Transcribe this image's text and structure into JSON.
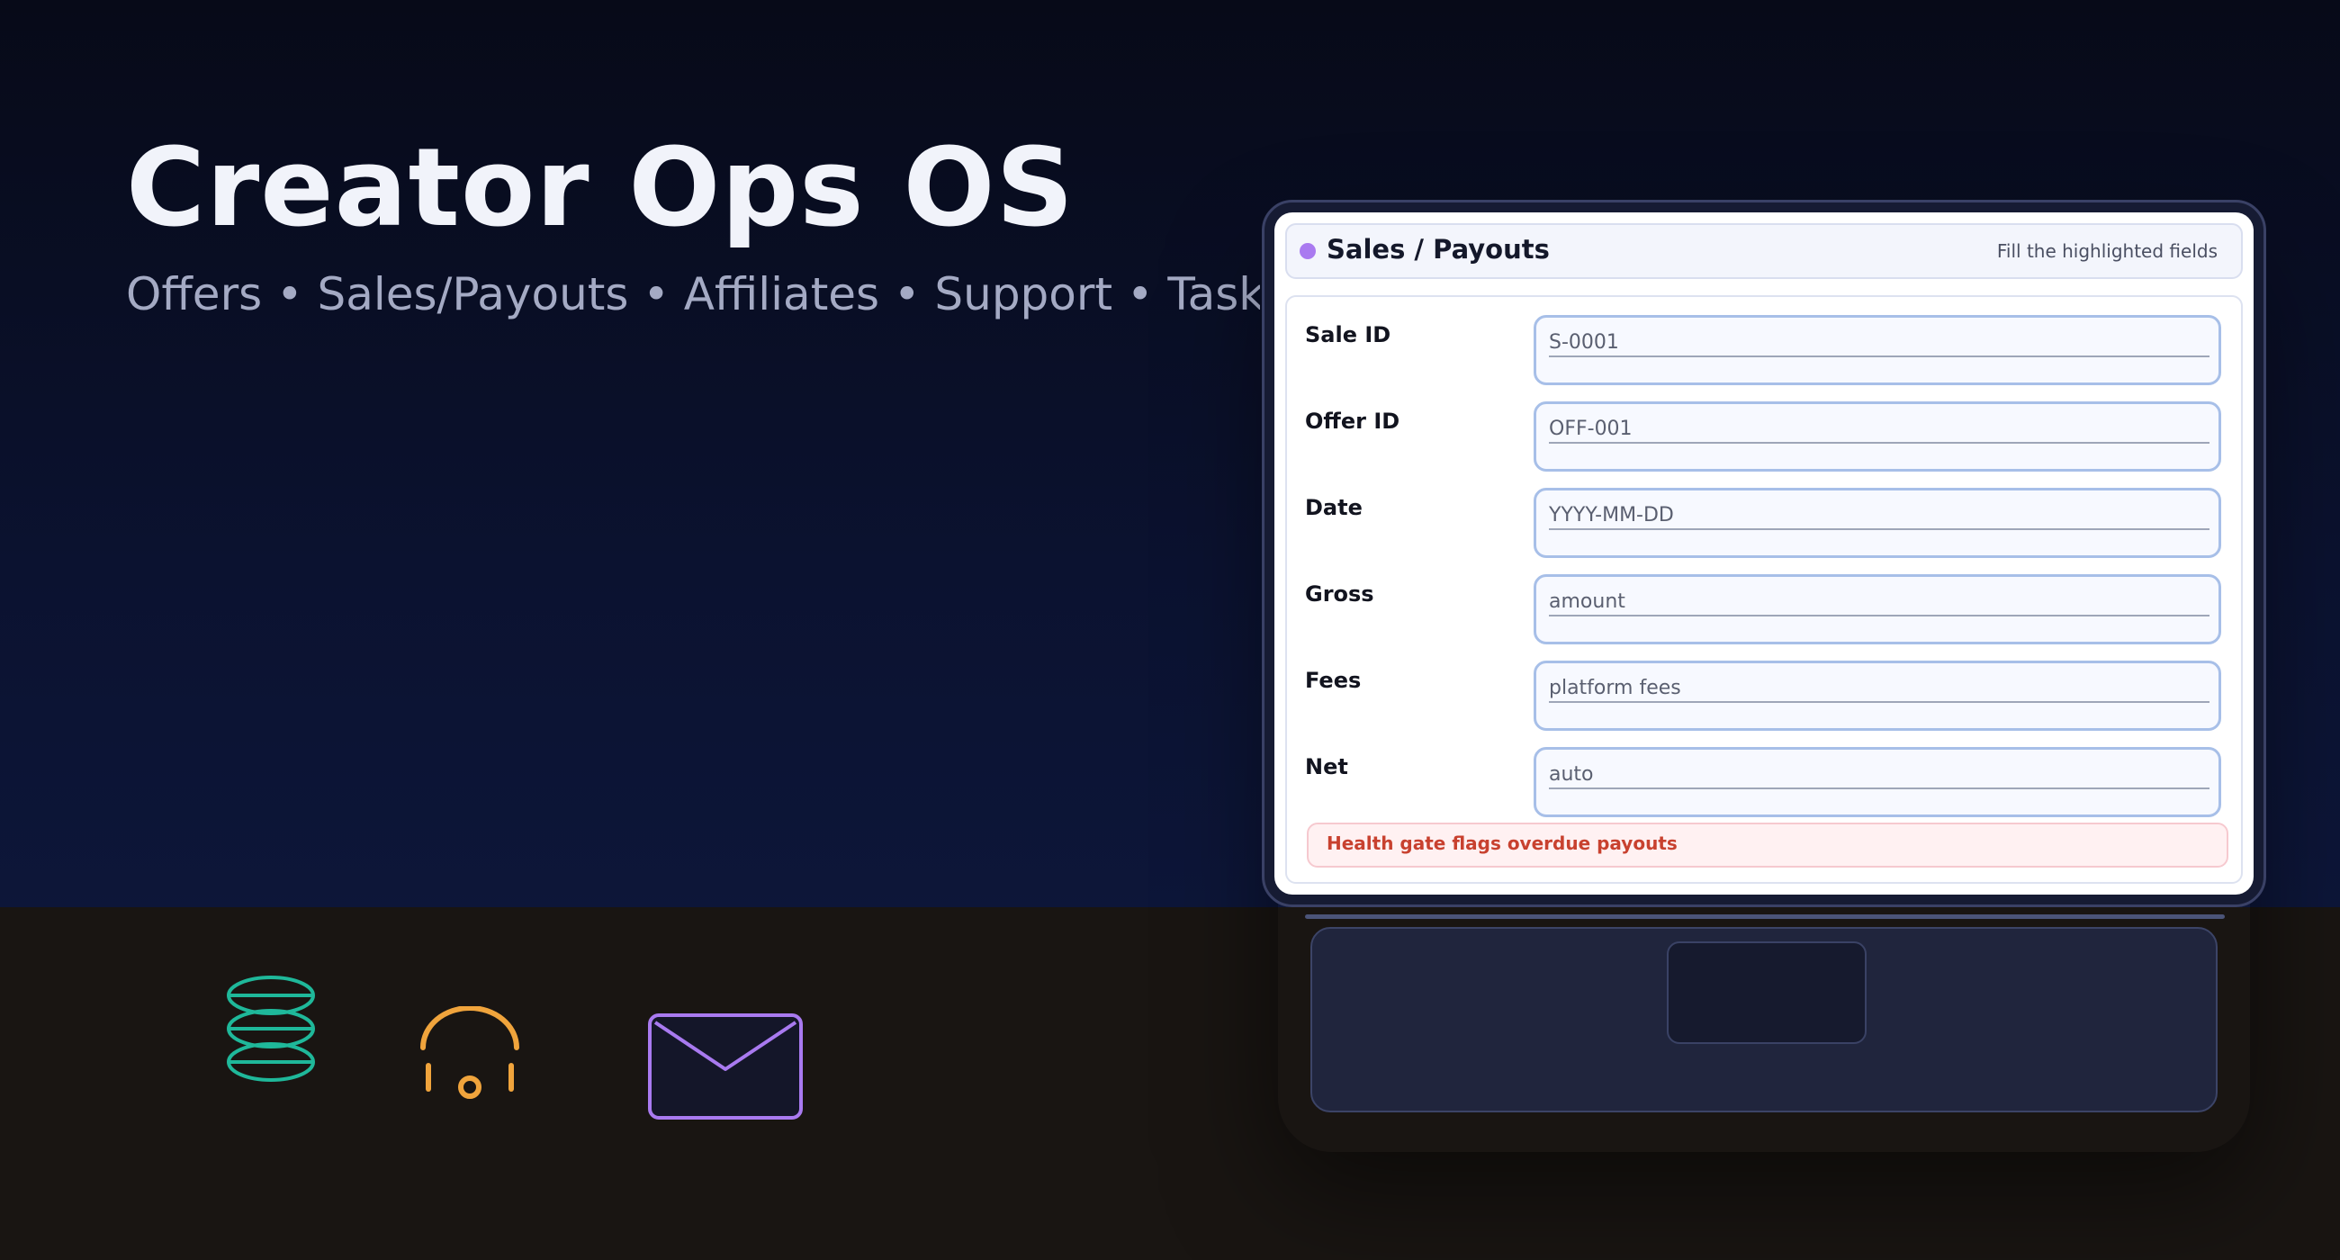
{
  "hero": {
    "title": "Creator Ops OS",
    "subtitle": "Offers • Sales/Payouts • Affiliates • Support • Tasks"
  },
  "floor_icons": [
    {
      "name": "database-icon",
      "color": "#1fb89a"
    },
    {
      "name": "headset-icon",
      "color": "#f0a43c"
    },
    {
      "name": "mail-icon",
      "color": "#a97af0"
    }
  ],
  "app": {
    "title": "Sales / Payouts",
    "hint": "Fill the highlighted fields",
    "accent_color": "#a97af0",
    "fields": [
      {
        "label": "Sale ID",
        "placeholder": "S-0001"
      },
      {
        "label": "Offer ID",
        "placeholder": "OFF-001"
      },
      {
        "label": "Date",
        "placeholder": "YYYY-MM-DD"
      },
      {
        "label": "Gross",
        "placeholder": "amount"
      },
      {
        "label": "Fees",
        "placeholder": "platform fees"
      },
      {
        "label": "Net",
        "placeholder": "auto"
      }
    ],
    "alert": {
      "text": "Health gate flags overdue payouts",
      "color": "#c8412f"
    }
  }
}
